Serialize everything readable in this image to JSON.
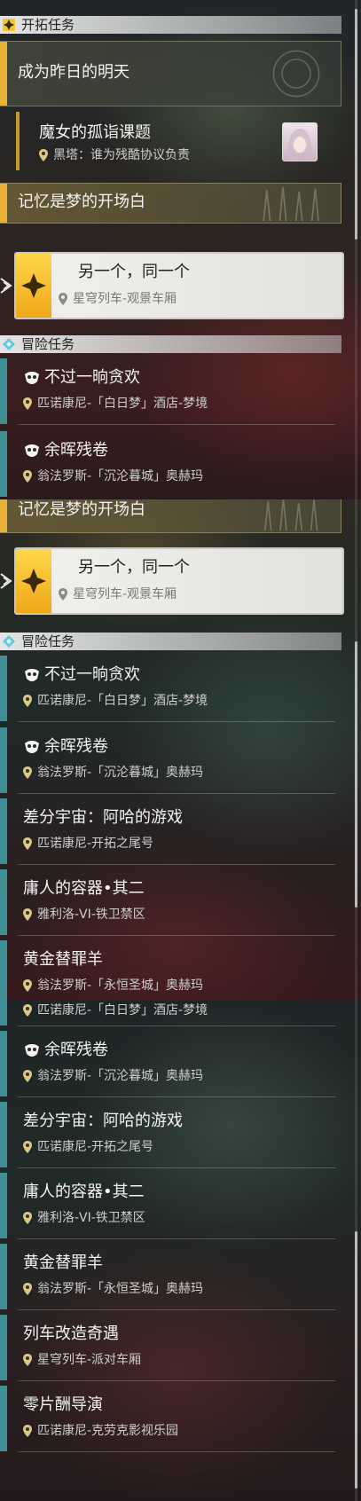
{
  "sections": {
    "trailblaze": "开拓任务",
    "adventure": "冒险任务"
  },
  "trailblaze_quests": {
    "yesterday": "成为昨日的明天",
    "witch_title": "魔女的孤诣课题",
    "witch_loc": "黑塔：谁为残酷协议负责",
    "memory": "记忆是梦的开场白"
  },
  "selected_quest": {
    "title": "另一个，同一个",
    "location": "星穹列车-观景车厢"
  },
  "adventure_quests": [
    {
      "title": "不过一晌贪欢",
      "location": "匹诺康尼-「白日梦」酒店-梦境"
    },
    {
      "title": "余晖残卷",
      "location": "翁法罗斯-「沉沦暮城」奥赫玛"
    },
    {
      "title": "差分宇宙：阿哈的游戏",
      "location": "匹诺康尼-开拓之尾号"
    },
    {
      "title": "庸人的容器•其二",
      "location": "雅利洛-VI-铁卫禁区"
    },
    {
      "title": "黄金替罪羊",
      "location": "翁法罗斯-「永恒圣城」奥赫玛"
    },
    {
      "title": "列车改造奇遇",
      "location": "星穹列车-派对车厢"
    },
    {
      "title": "零片酬导演",
      "location": "匹诺康尼-克劳克影视乐园"
    }
  ],
  "icons": {
    "trailblaze_section": "trailblaze-diamond-icon",
    "adventure_section": "adventure-diamond-icon",
    "location": "location-pin-icon",
    "hourglass": "hourglass-icon",
    "adventure_type": "adventure-mask-icon",
    "selected_arrow": "selected-arrow-icon"
  },
  "colors": {
    "trailblaze_accent": "#e8b236",
    "adventure_accent": "#3f8f95",
    "selected_gold": "#f5c031",
    "adventure_icon_cyan": "#5fc9e0"
  }
}
